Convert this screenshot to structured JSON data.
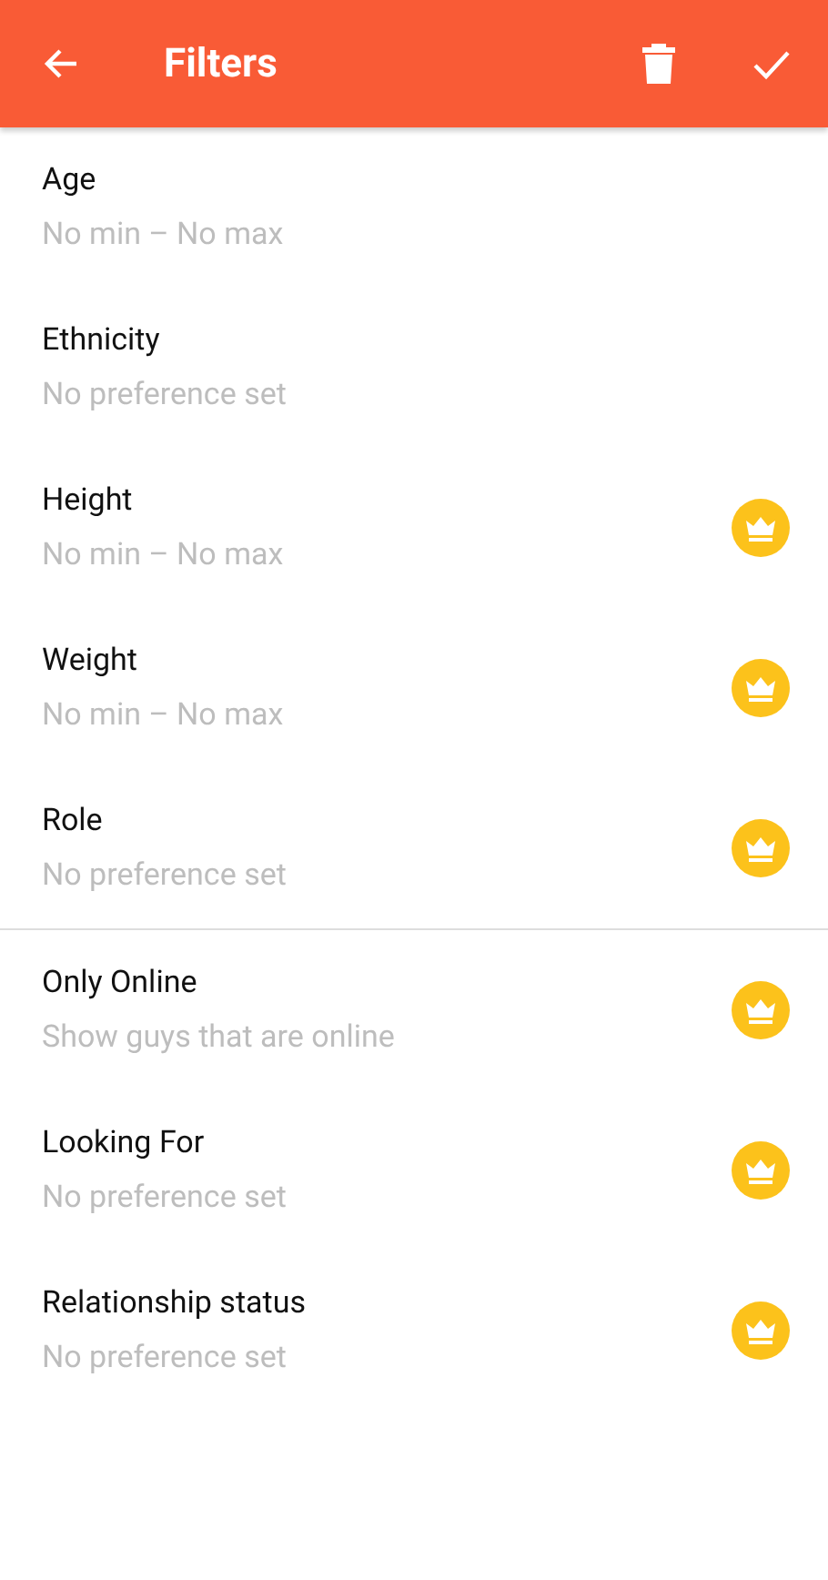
{
  "app_bar": {
    "title": "Filters"
  },
  "sections": [
    {
      "items": [
        {
          "label": "Age",
          "value": "No min – No max",
          "premium": false
        },
        {
          "label": "Ethnicity",
          "value": "No preference set",
          "premium": false
        },
        {
          "label": "Height",
          "value": "No min – No max",
          "premium": true
        },
        {
          "label": "Weight",
          "value": "No min – No max",
          "premium": true
        },
        {
          "label": "Role",
          "value": "No preference set",
          "premium": true
        }
      ]
    },
    {
      "items": [
        {
          "label": "Only Online",
          "value": "Show guys that are online",
          "premium": true
        },
        {
          "label": "Looking For",
          "value": "No preference set",
          "premium": true
        },
        {
          "label": "Relationship status",
          "value": "No preference set",
          "premium": true
        }
      ]
    }
  ]
}
